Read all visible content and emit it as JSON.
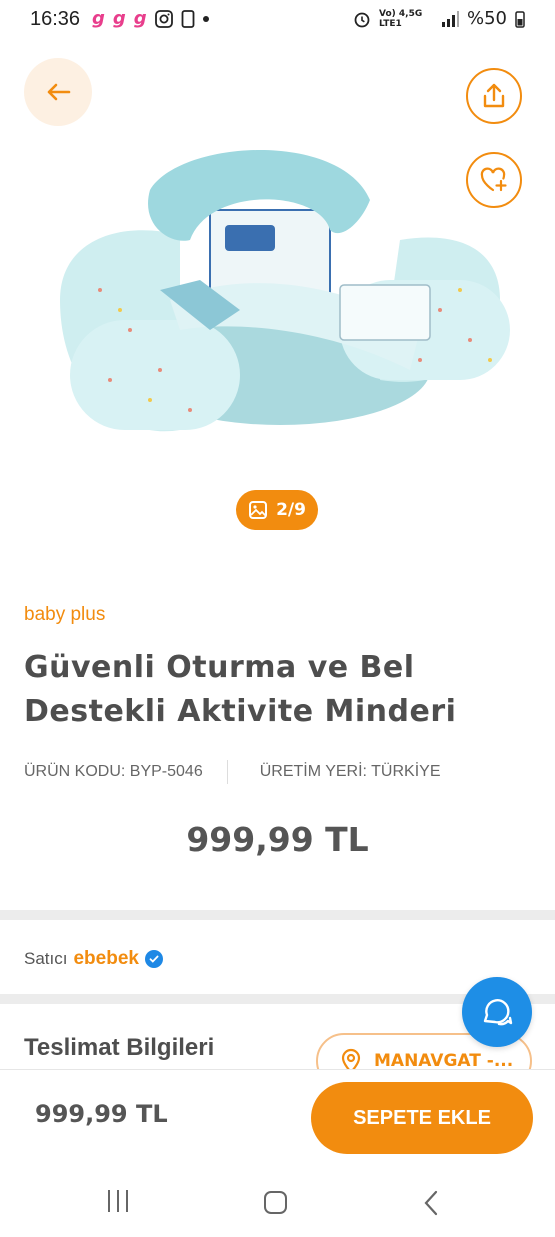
{
  "status_bar": {
    "time": "16:36",
    "app_icons": [
      "g",
      "g",
      "g"
    ],
    "battery": "%50",
    "network": "Vo) 4,5G LTE1"
  },
  "product": {
    "brand": "baby plus",
    "title": "Güvenli Oturma ve Bel Destekli Aktivite Minderi",
    "code_label": "ÜRÜN KODU: BYP-5046",
    "origin_label": "ÜRETİM YERİ: TÜRKİYE",
    "price": "999,99 TL",
    "image_counter": "2/9"
  },
  "seller": {
    "label": "Satıcı",
    "name": "ebebek"
  },
  "delivery": {
    "title": "Teslimat Bilgileri",
    "location": "MANAVGAT -..."
  },
  "bottom_bar": {
    "price": "999,99 TL",
    "add_to_cart": "SEPETE EKLE"
  },
  "colors": {
    "accent": "#f28c0f",
    "fab": "#1e8ee6"
  },
  "icons": {
    "back": "arrow-left-icon",
    "share": "share-icon",
    "favorite": "heart-plus-icon",
    "counter": "image-icon",
    "chat": "chat-icon",
    "location": "location-pin-icon"
  }
}
